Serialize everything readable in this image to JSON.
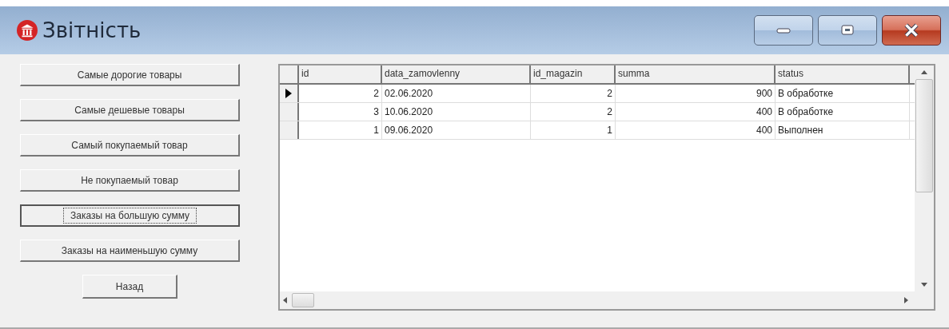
{
  "window": {
    "title": "Звітність"
  },
  "buttons": [
    {
      "label": "Самые дорогие товары",
      "focused": false
    },
    {
      "label": "Самые дешевые товары",
      "focused": false
    },
    {
      "label": "Самый покупаемый товар",
      "focused": false
    },
    {
      "label": "Не покупаемый товар",
      "focused": false
    },
    {
      "label": "Заказы на большую сумму",
      "focused": true
    },
    {
      "label": "Заказы на наименьшую сумму",
      "focused": false
    }
  ],
  "back_button": {
    "label": "Назад"
  },
  "table": {
    "columns": [
      "id",
      "data_zamovlenny",
      "id_magazin",
      "summa",
      "status"
    ],
    "rows": [
      {
        "current": true,
        "cells": [
          "2",
          "02.06.2020",
          "2",
          "900",
          "В обработке"
        ]
      },
      {
        "current": false,
        "cells": [
          "3",
          "10.06.2020",
          "2",
          "400",
          "В обработке"
        ]
      },
      {
        "current": false,
        "cells": [
          "1",
          "09.06.2020",
          "1",
          "400",
          "Выполнен"
        ]
      }
    ]
  }
}
